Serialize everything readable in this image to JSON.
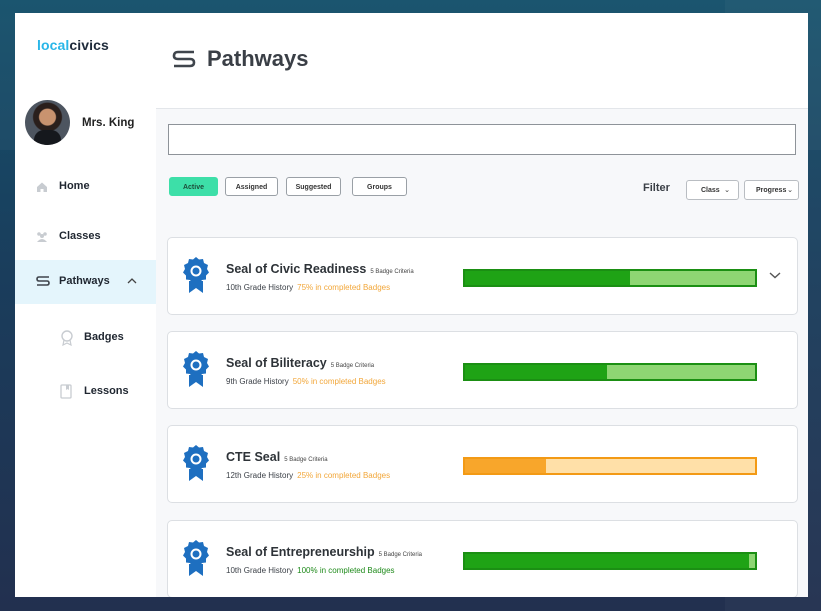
{
  "app": {
    "logo_part1": "local",
    "logo_part2": "civics"
  },
  "user": {
    "name": "Mrs. King"
  },
  "sidebar": {
    "items": [
      {
        "label": "Home",
        "icon": "home-icon"
      },
      {
        "label": "Classes",
        "icon": "classes-icon"
      },
      {
        "label": "Pathways",
        "icon": "pathways-icon",
        "active": true,
        "expanded": true
      },
      {
        "label": "Badges",
        "icon": "badge-outline-icon",
        "sub": true
      },
      {
        "label": "Lessons",
        "icon": "lesson-icon",
        "sub": true
      }
    ]
  },
  "header": {
    "title": "Pathways",
    "icon": "pathways-icon"
  },
  "search": {
    "placeholder": "",
    "value": ""
  },
  "tabs": [
    {
      "label": "Active",
      "active": true
    },
    {
      "label": "Assigned"
    },
    {
      "label": "Suggested"
    },
    {
      "label": "Groups"
    }
  ],
  "filter": {
    "label": "Filter",
    "class_label": "Class",
    "progress_label": "Progress"
  },
  "pathways": [
    {
      "title": "Seal of Civic Readiness",
      "criteria": "5 Badge Criteria",
      "grade": "10th Grade History",
      "progress_text": "75% in completed Badges",
      "progress": 0.57,
      "color": "green",
      "text_color": "#f2a73a",
      "expandable": true
    },
    {
      "title": "Seal of Biliteracy",
      "criteria": "5 Badge Criteria",
      "grade": "9th Grade History",
      "progress_text": "50% in completed Badges",
      "progress": 0.49,
      "color": "green",
      "text_color": "#f2a73a",
      "expandable": false
    },
    {
      "title": "CTE Seal",
      "criteria": "5 Badge Criteria",
      "grade": "12th Grade History",
      "progress_text": "25% in completed Badges",
      "progress": 0.28,
      "color": "orange",
      "text_color": "#f2a73a",
      "expandable": false
    },
    {
      "title": "Seal of Entrepreneurship",
      "criteria": "5 Badge Criteria",
      "grade": "10th Grade History",
      "progress_text": "100% in completed Badges",
      "progress": 0.98,
      "color": "green",
      "text_color": "#1e8a1a",
      "expandable": false
    }
  ],
  "colors": {
    "accent": "#29b6e8",
    "active_tab": "#3ddfa8",
    "bar_green_dark": "#1fa315",
    "bar_green_light": "#8ed673",
    "bar_orange_dark": "#f8a62b",
    "bar_orange_light": "#ffe0a8",
    "badge_blue": "#1e6fc0"
  }
}
